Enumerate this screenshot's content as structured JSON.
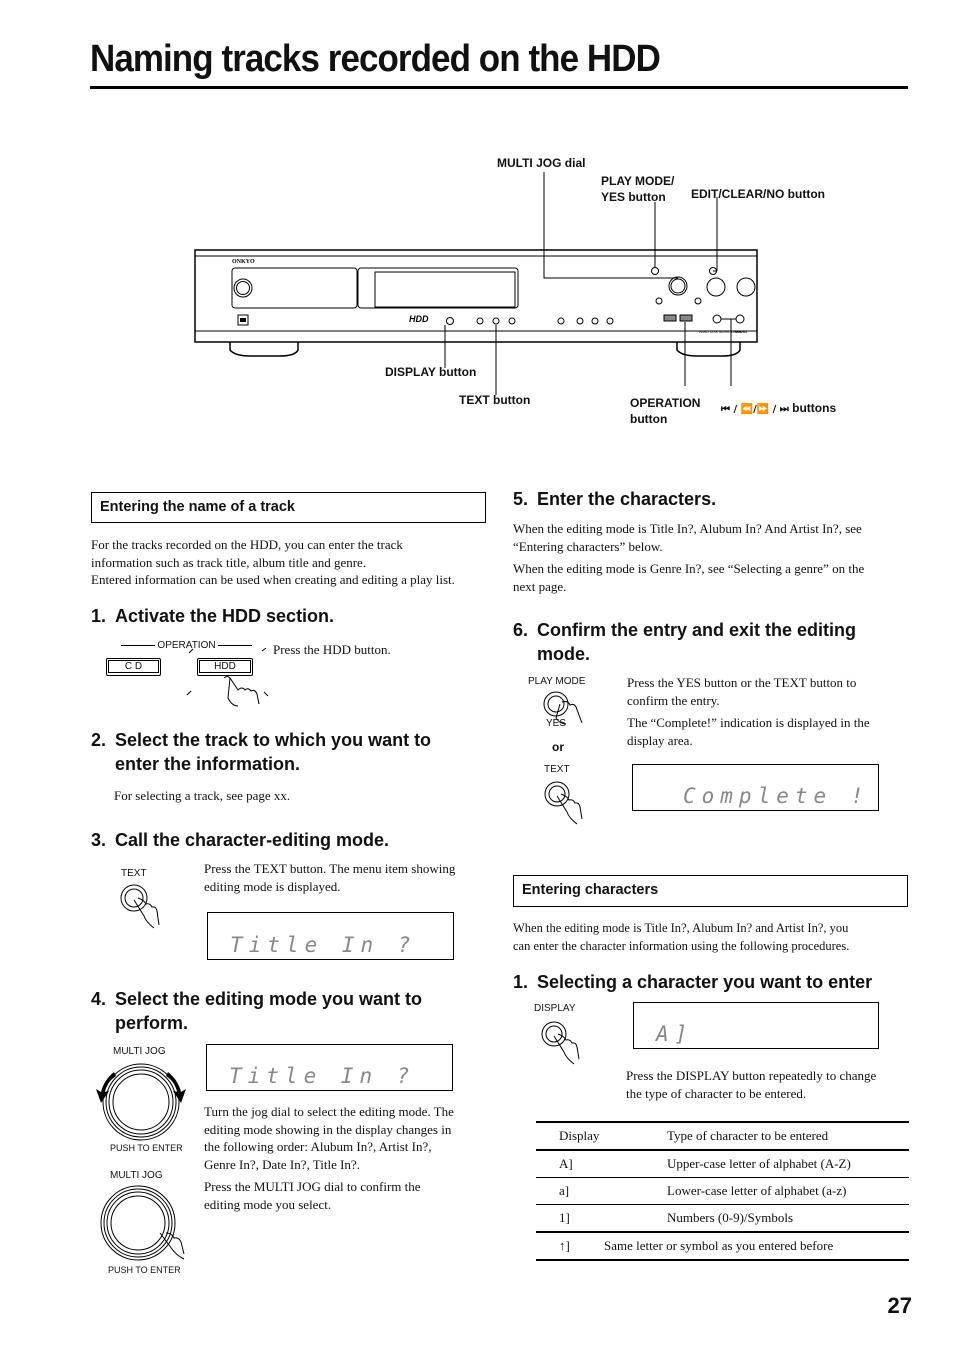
{
  "page": {
    "title": "Naming tracks recorded on the HDD",
    "page_number": "27"
  },
  "device": {
    "brand": "ONKYO",
    "model": "MB-S1",
    "model_caption": "HARD DISK MUSIC LIBRARY",
    "hdd_logo": "HDD",
    "callouts": {
      "multi_jog": "MULTI JOG dial",
      "play_mode_yes_1": "PLAY MODE/",
      "play_mode_yes_2": "YES button",
      "edit_clear_no": "EDIT/CLEAR/NO button",
      "display": "DISPLAY button",
      "text": "TEXT button",
      "operation_1": "OPERATION",
      "operation_2": "button",
      "skip_buttons_icons": "⏮ / ⏪/⏩ / ⏭",
      "skip_buttons_label": "buttons"
    }
  },
  "left": {
    "section_header": "Entering the name of a track",
    "intro": [
      "For the tracks recorded on the HDD, you can enter the track",
      "information such as track title, album title and genre.",
      "Entered information can be used when creating and editing a play list."
    ],
    "step1": {
      "num": "1.",
      "title": "Activate the HDD section.",
      "fig_group_label": "OPERATION",
      "fig_cd": "C D",
      "fig_hdd": "HDD",
      "text": "Press the HDD button."
    },
    "step2": {
      "num": "2.",
      "title_line1": "Select the track to which you want to",
      "title_line2": "enter the information.",
      "text": "For selecting a track, see page xx."
    },
    "step3": {
      "num": "3.",
      "title": "Call the character-editing mode.",
      "fig_label": "TEXT",
      "text_line1": "Press the TEXT button. The menu item showing",
      "text_line2": "editing mode is displayed.",
      "lcd": "Title In ?"
    },
    "step4": {
      "num": "4.",
      "title_line1": "Select the editing mode you want to",
      "title_line2": "perform.",
      "fig_label_top": "MULTI JOG",
      "fig_caption_top": "PUSH TO ENTER",
      "fig_label_bottom": "MULTI JOG",
      "fig_caption_bottom": "PUSH TO ENTER",
      "lcd": "Title In ?",
      "text1": [
        "Turn the jog dial to select the editing mode. The",
        "editing mode showing in the display changes in",
        "the following order: Alubum In?, Artist In?,",
        "Genre In?, Date In?, Title In?."
      ],
      "text2": [
        "Press the MULTI JOG dial to confirm the",
        "editing mode you select."
      ]
    }
  },
  "right": {
    "step5": {
      "num": "5.",
      "title": "Enter the characters.",
      "text1": [
        "When the editing mode is Title In?, Alubum In? And Artist In?, see",
        "“Entering characters” below."
      ],
      "text2": [
        "When the editing mode is Genre In?, see “Selecting a genre” on the",
        "next page."
      ]
    },
    "step6": {
      "num": "6.",
      "title_line1": "Confirm the entry and exit the editing",
      "title_line2": "mode.",
      "fig_label_top": "PLAY MODE",
      "fig_label_yes": "YES",
      "fig_or": "or",
      "fig_label_text": "TEXT",
      "text1": [
        "Press the YES button or the TEXT button to",
        "confirm the entry."
      ],
      "text2": [
        "The “Complete!” indication is displayed in the",
        "display area."
      ],
      "lcd": "Complete !"
    },
    "entering_chars": {
      "section_header": "Entering characters",
      "intro": [
        "When the editing mode is Title In?, Alubum In? and Artist In?, you",
        "can enter the character information using the following procedures."
      ],
      "sub1": {
        "num": "1.",
        "title": "Selecting a character you want to enter",
        "fig_label": "DISPLAY",
        "lcd": "A]",
        "text": [
          "Press the DISPLAY button repeatedly to change",
          "the type of character to be entered."
        ]
      },
      "table": {
        "headers": [
          "Display",
          "Type of character to be entered"
        ],
        "rows": [
          [
            "A]",
            "Upper-case letter of alphabet (A-Z)"
          ],
          [
            "a]",
            "Lower-case letter of alphabet (a-z)"
          ],
          [
            "1]",
            "Numbers (0-9)/Symbols"
          ],
          [
            "↑]",
            "Same letter or symbol as you entered before"
          ]
        ]
      }
    }
  }
}
